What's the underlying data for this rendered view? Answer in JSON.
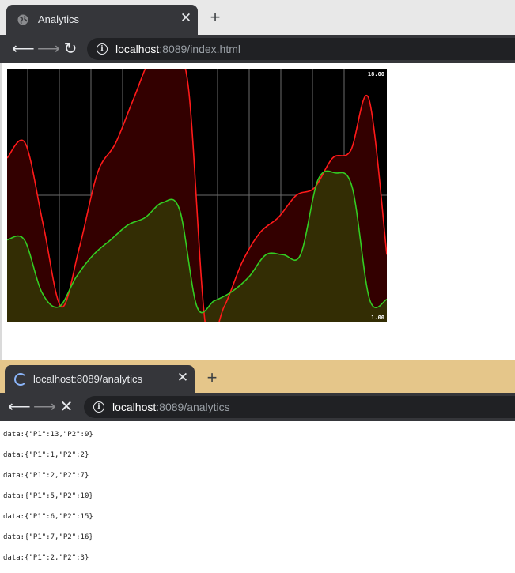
{
  "window1": {
    "tab": {
      "title": "Analytics",
      "close": "✕",
      "new_tab": "+"
    },
    "address": {
      "host": "localhost",
      "rest": ":8089/index.html"
    }
  },
  "window2": {
    "tab": {
      "title": "localhost:8089/analytics",
      "close": "✕",
      "new_tab": "+"
    },
    "address": {
      "host": "localhost",
      "rest": ":8089/analytics"
    },
    "log_lines": [
      "data:{\"P1\":13,\"P2\":9}",
      "data:{\"P1\":1,\"P2\":2}",
      "data:{\"P1\":2,\"P2\":7}",
      "data:{\"P1\":5,\"P2\":10}",
      "data:{\"P1\":6,\"P2\":15}",
      "data:{\"P1\":7,\"P2\":16}",
      "data:{\"P1\":2,\"P2\":3}"
    ]
  },
  "chart_data": {
    "type": "area",
    "ylim": [
      1,
      18
    ],
    "y_max_label": "18.00",
    "y_min_label": "1.00",
    "grid": true,
    "background": "#000000",
    "x": [
      0,
      1,
      2,
      3,
      4,
      5,
      6,
      7,
      8,
      9,
      10,
      11,
      12,
      13,
      14,
      15,
      16,
      17,
      18,
      19,
      20,
      21,
      22,
      23,
      24
    ],
    "series": [
      {
        "color": "#ff1a1a",
        "fill": "#330000",
        "values": [
          12,
          13,
          7.5,
          2,
          6,
          11,
          13,
          16,
          18.8,
          18.8,
          17,
          0.5,
          2,
          5,
          7,
          8,
          9.5,
          10,
          12,
          12.5,
          16,
          5.5
        ]
      },
      {
        "color": "#33cc22",
        "fill": "#332d04",
        "values": [
          6.5,
          6.5,
          3,
          2,
          4,
          5.5,
          6.5,
          7.5,
          8,
          9,
          8.5,
          2,
          2.4,
          3,
          4,
          5.5,
          5.5,
          5.5,
          10.5,
          11,
          10,
          2.5,
          2.5
        ]
      }
    ]
  }
}
